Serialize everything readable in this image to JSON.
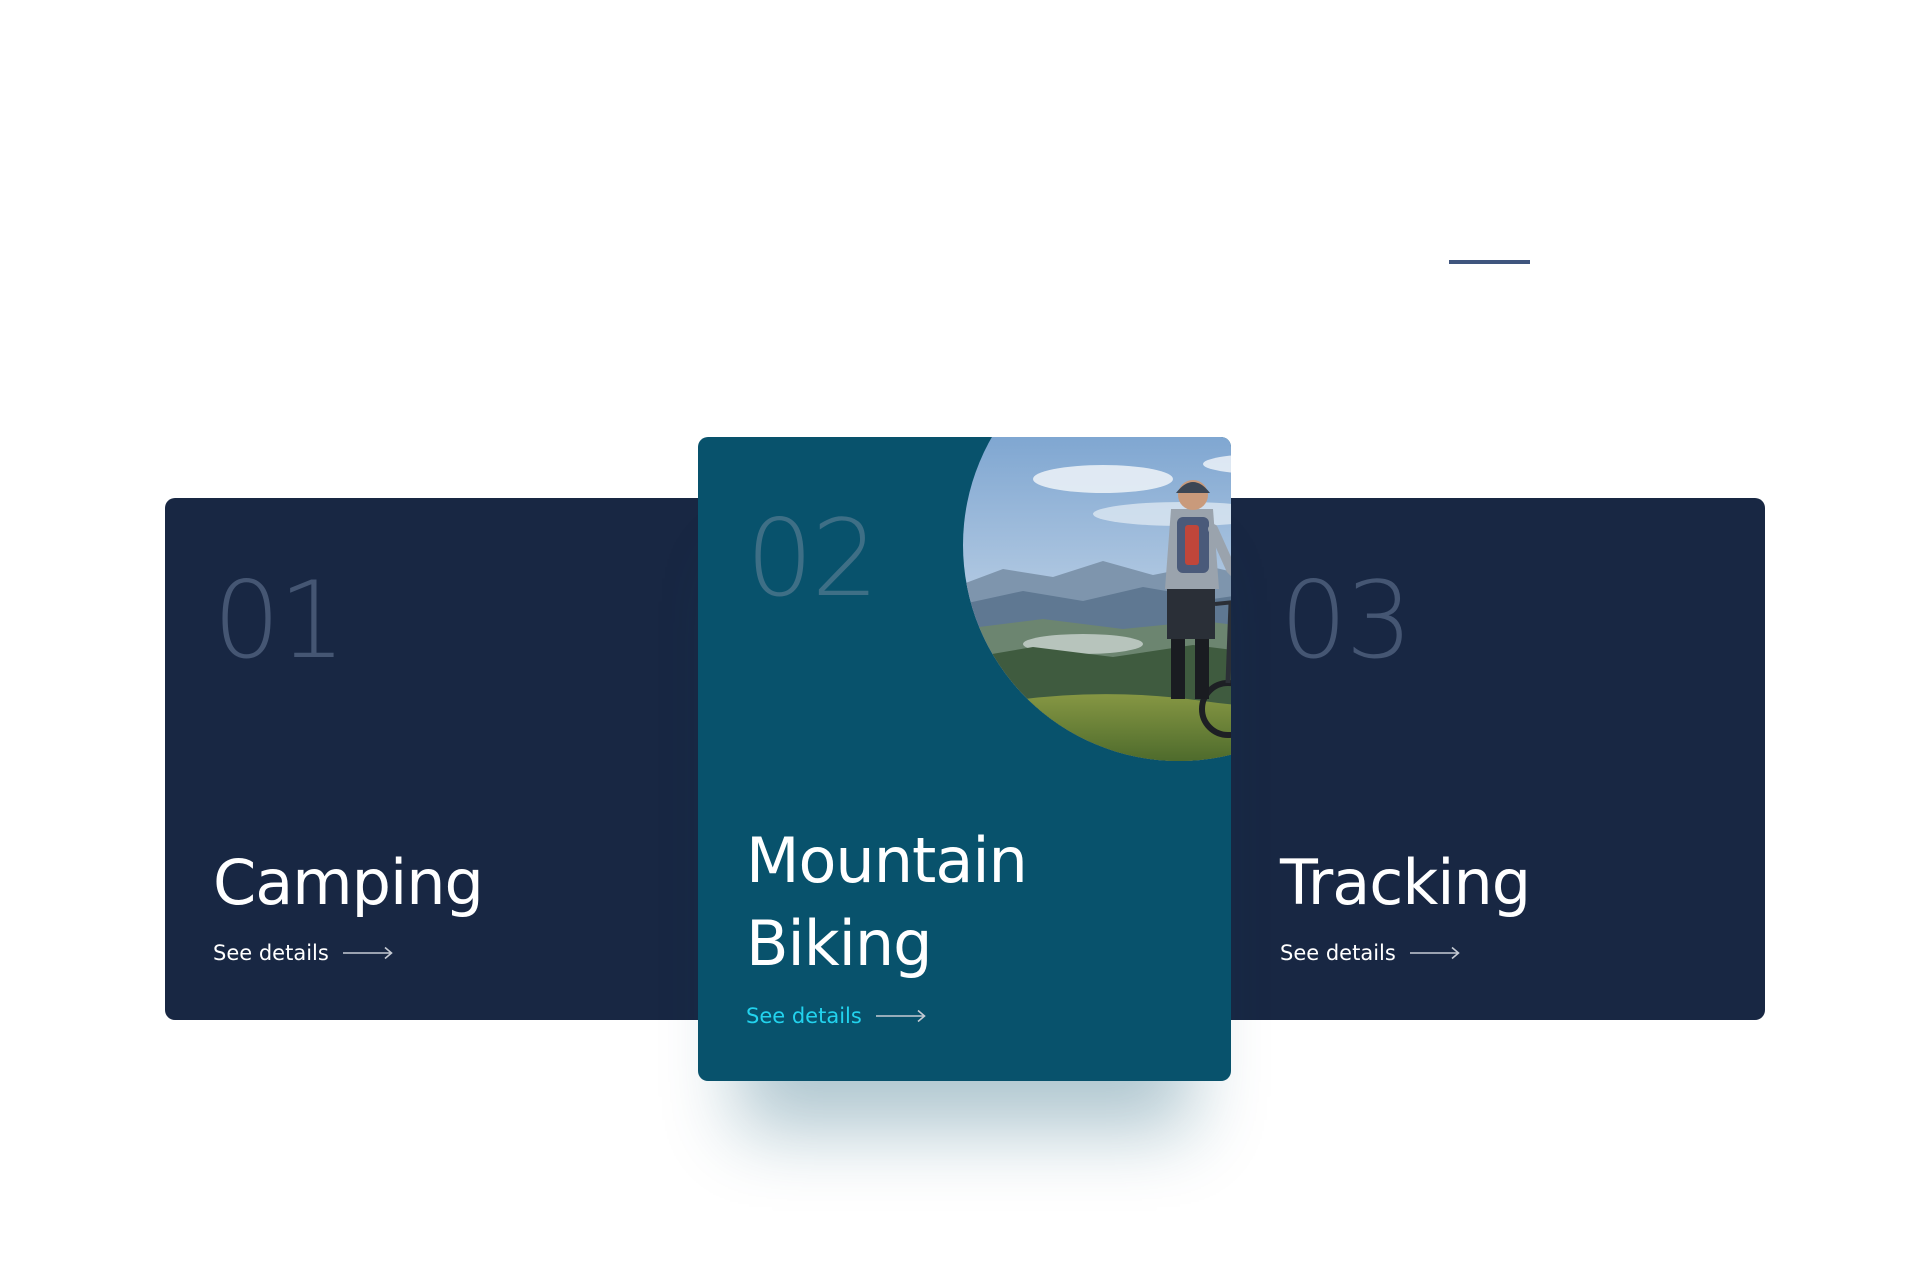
{
  "decor": {
    "accent_rule_color": "#3f557e"
  },
  "cards": [
    {
      "number": "01",
      "title": "Camping",
      "link_label": "See details",
      "link_icon": "arrow-right-icon",
      "background": "#182743",
      "link_color": "#ffffff"
    },
    {
      "number": "02",
      "title": "Mountain Biking",
      "link_label": "See details",
      "link_icon": "arrow-right-icon",
      "image": "mountain-biker-photo",
      "background": "#08526c",
      "link_color": "#22d3ee",
      "featured": true
    },
    {
      "number": "03",
      "title": "Tracking",
      "link_label": "See details",
      "link_icon": "arrow-right-icon",
      "background": "#182743",
      "link_color": "#ffffff"
    }
  ]
}
